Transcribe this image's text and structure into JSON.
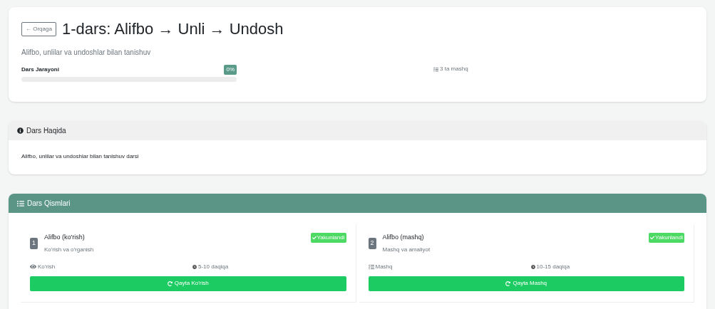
{
  "header": {
    "back_button": "← Orqaga",
    "title": "1-dars: Alifbo → Unli → Undosh",
    "subtitle": "Alifbo, unlilar va undoshlar bilan tanishuv",
    "progress": {
      "label": "Dars Jarayoni",
      "badge": "0%",
      "level": 0
    },
    "exercise_count": "3 ta mashq"
  },
  "about": {
    "title": "Dars Haqida",
    "text": "Alifbo, unlilar va undoshlar bilan tanishuv darsi"
  },
  "parts": {
    "title": "Dars Qismlari",
    "items": [
      {
        "number": "1",
        "title": "Alifbo (ko'rish)",
        "subtitle": "Ko'rish va o'rganish",
        "completed": true,
        "status": "Yakunlandi",
        "kind": "view",
        "type_label": "Ko'rish",
        "duration": "5-10 daqiqa",
        "action": "Qayta Ko'rish"
      },
      {
        "number": "2",
        "title": "Alifbo (mashq)",
        "subtitle": "Mashq va amaliyot",
        "completed": true,
        "status": "Yakunlandi",
        "kind": "practice",
        "type_label": "Mashq",
        "duration": "10-15 daqiqa",
        "action": "Qayta Mashq"
      }
    ]
  }
}
